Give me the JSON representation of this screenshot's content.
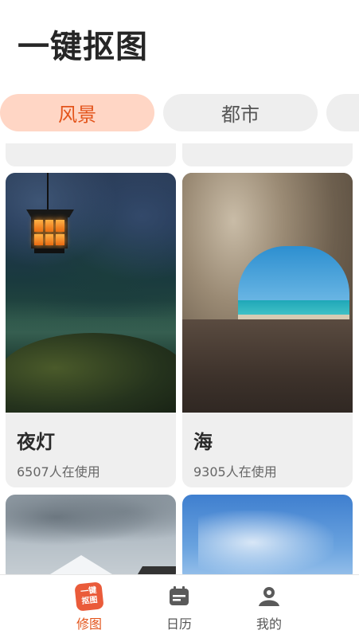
{
  "app": {
    "title": "一键抠图"
  },
  "categories": [
    {
      "label": "风景",
      "active": true
    },
    {
      "label": "都市",
      "active": false
    },
    {
      "label": "",
      "active": false
    }
  ],
  "templates": [
    {
      "name": "夜灯",
      "usage": "6507人在使用"
    },
    {
      "name": "海",
      "usage": "9305人在使用"
    },
    {
      "name": "",
      "usage": ""
    },
    {
      "name": "",
      "usage": ""
    }
  ],
  "bottom_nav": {
    "items": [
      {
        "label": "修图",
        "icon": "cutout-logo-icon",
        "active": true,
        "logo_line1": "一键",
        "logo_line2": "抠图"
      },
      {
        "label": "日历",
        "icon": "calendar-icon",
        "active": false
      },
      {
        "label": "我的",
        "icon": "user-icon",
        "active": false
      }
    ]
  },
  "colors": {
    "accent": "#e3541b",
    "tab_active_bg": "#ffd6c5",
    "tab_bg": "#eeeeee",
    "card_bg": "#efefef"
  }
}
